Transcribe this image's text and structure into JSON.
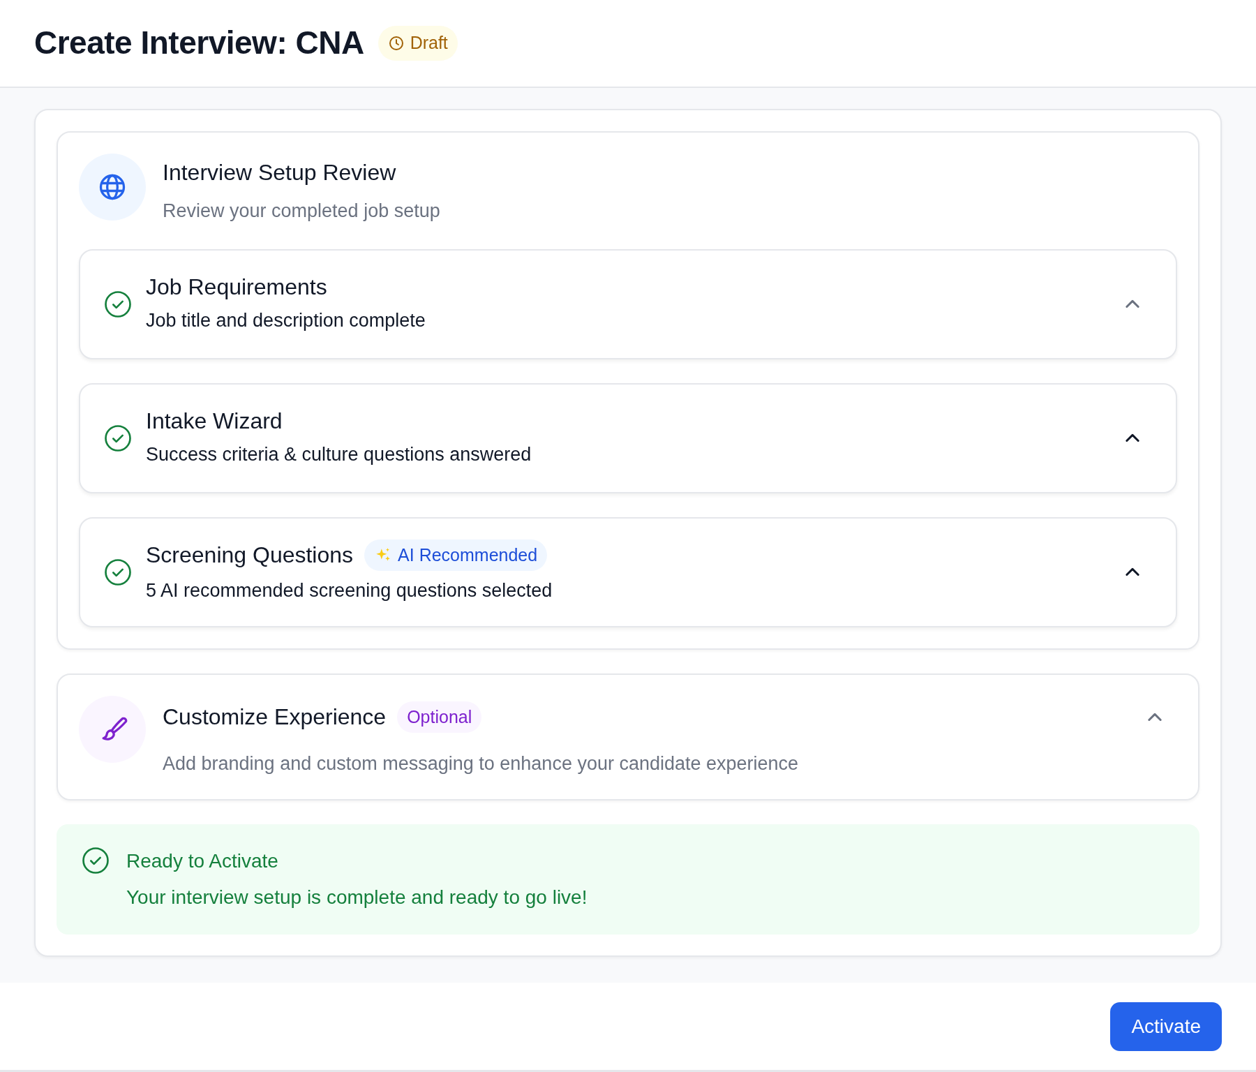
{
  "header": {
    "title": "Create Interview: CNA",
    "status_badge": "Draft"
  },
  "review": {
    "title": "Interview Setup Review",
    "subtitle": "Review your completed job setup",
    "steps": [
      {
        "title": "Job Requirements",
        "description": "Job title and description complete",
        "completed": true,
        "expanded": true
      },
      {
        "title": "Intake Wizard",
        "description": "Success criteria & culture questions answered",
        "completed": true,
        "expanded": true
      },
      {
        "title": "Screening Questions",
        "badge": "AI Recommended",
        "description": "5 AI recommended screening questions selected",
        "completed": true,
        "expanded": true
      }
    ]
  },
  "customize": {
    "title": "Customize Experience",
    "badge": "Optional",
    "description": "Add branding and custom messaging to enhance your candidate experience",
    "expanded": true
  },
  "ready": {
    "title": "Ready to Activate",
    "message": "Your interview setup is complete and ready to go live!"
  },
  "footer": {
    "button": "Activate"
  }
}
